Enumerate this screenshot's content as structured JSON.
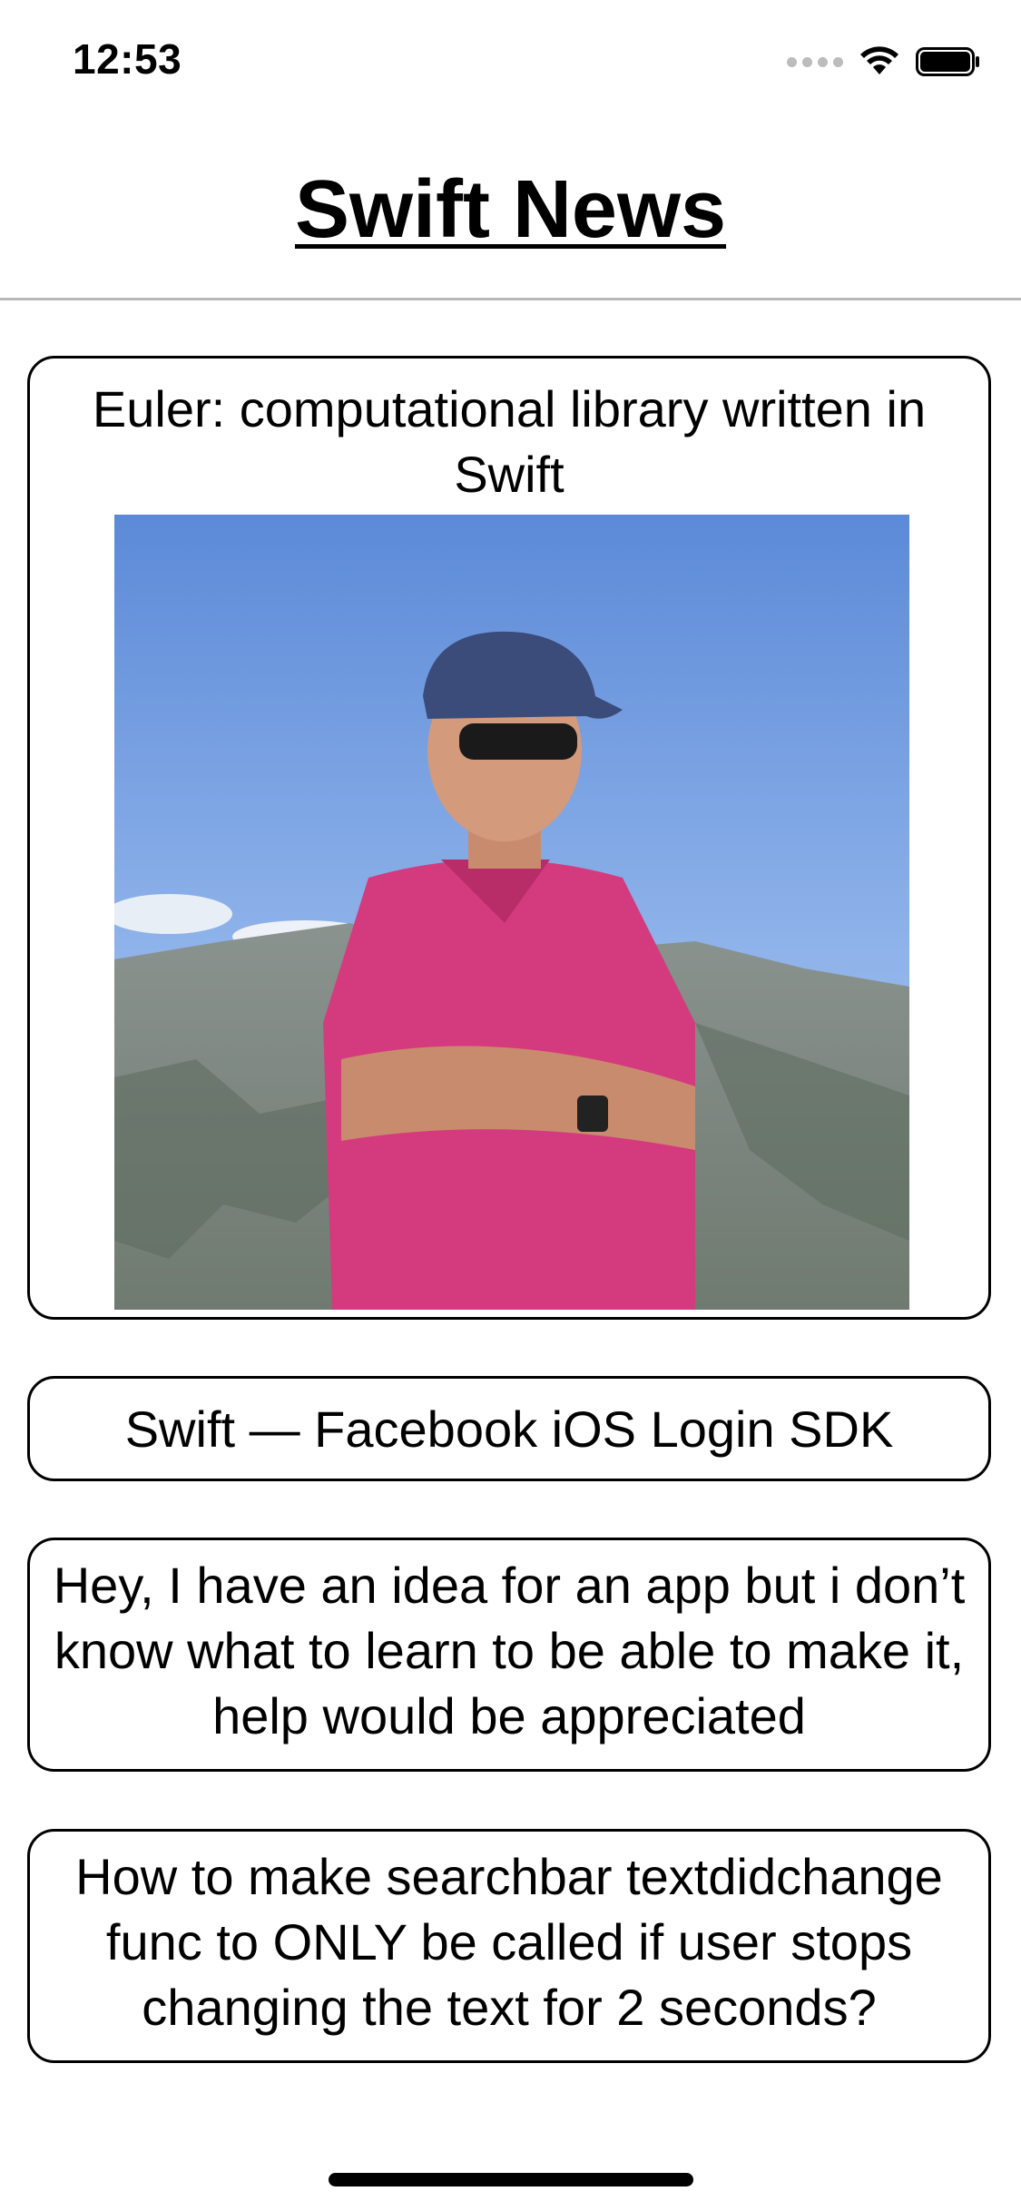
{
  "status_bar": {
    "time": "12:53",
    "icons": [
      "cellular-signal-icon",
      "wifi-icon",
      "battery-icon"
    ]
  },
  "nav": {
    "title": "Swift News"
  },
  "articles": [
    {
      "title": "Euler: computational library written in Swift",
      "has_image": true,
      "image_description_icon": "photo-thumbnail"
    },
    {
      "title": "Swift — Facebook iOS Login SDK",
      "has_image": false
    },
    {
      "title": "Hey, I have an idea for an app but i don’t know what to learn to be able to make it, help would be appreciated",
      "has_image": false
    },
    {
      "title": "How to make searchbar textdidchange func to ONLY be called if user stops changing the text for 2 seconds?",
      "has_image": false
    }
  ],
  "colors": {
    "background": "#ffffff",
    "text": "#000000",
    "divider": "#b8b8b8",
    "card_border": "#000000"
  }
}
